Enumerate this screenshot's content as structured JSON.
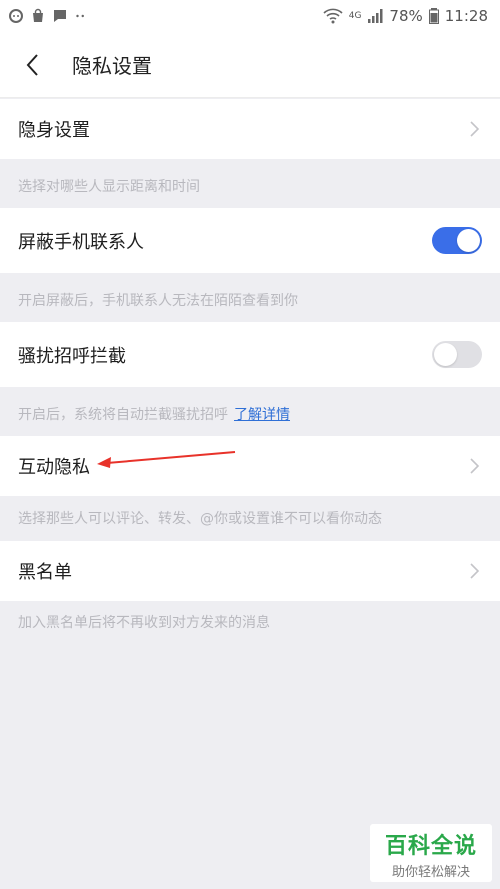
{
  "status_bar": {
    "battery": "78%",
    "time": "11:28",
    "network": "4G"
  },
  "header": {
    "title": "隐私设置"
  },
  "settings": {
    "invisible": {
      "label": "隐身设置",
      "hint": "选择对哪些人显示距离和时间"
    },
    "block_contacts": {
      "label": "屏蔽手机联系人",
      "enabled": true,
      "hint": "开启屏蔽后，手机联系人无法在陌陌查看到你"
    },
    "harass_block": {
      "label": "骚扰招呼拦截",
      "enabled": false,
      "hint": "开启后，系统将自动拦截骚扰招呼",
      "link": "了解详情"
    },
    "interaction_privacy": {
      "label": "互动隐私",
      "hint": "选择那些人可以评论、转发、@你或设置谁不可以看你动态"
    },
    "blacklist": {
      "label": "黑名单",
      "hint": "加入黑名单后将不再收到对方发来的消息"
    }
  },
  "colors": {
    "toggle_on": "#3a6ee8",
    "annotation": "#e8322a",
    "watermark": "#2aa84a"
  },
  "watermark": {
    "title": "百科全说",
    "subtitle": "助你轻松解决"
  }
}
